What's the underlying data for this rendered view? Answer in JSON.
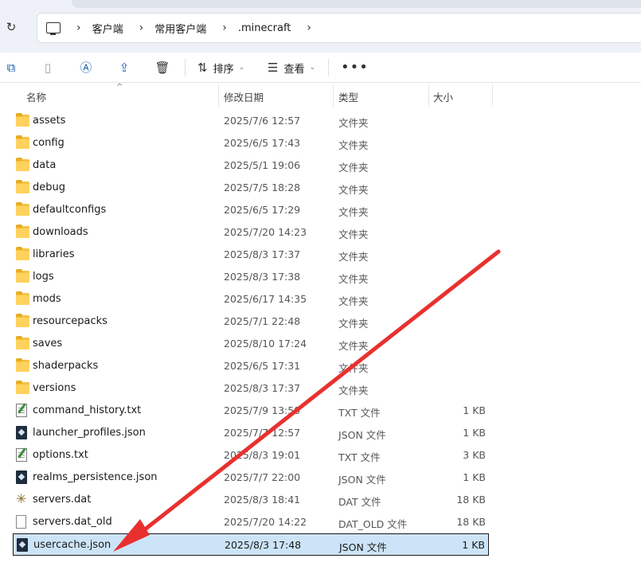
{
  "address": {
    "crumbs": [
      "客户端",
      "常用客户端",
      ".minecraft"
    ]
  },
  "toolbar": {
    "sort_label": "排序",
    "view_label": "查看"
  },
  "columns": {
    "name": "名称",
    "date": "修改日期",
    "type": "类型",
    "size": "大小"
  },
  "files": [
    {
      "icon": "folder-icon",
      "name": "assets",
      "date": "2025/7/6 12:57",
      "type": "文件夹",
      "size": ""
    },
    {
      "icon": "folder-icon",
      "name": "config",
      "date": "2025/6/5 17:43",
      "type": "文件夹",
      "size": ""
    },
    {
      "icon": "folder-icon",
      "name": "data",
      "date": "2025/5/1 19:06",
      "type": "文件夹",
      "size": ""
    },
    {
      "icon": "folder-icon",
      "name": "debug",
      "date": "2025/7/5 18:28",
      "type": "文件夹",
      "size": ""
    },
    {
      "icon": "folder-icon",
      "name": "defaultconfigs",
      "date": "2025/6/5 17:29",
      "type": "文件夹",
      "size": ""
    },
    {
      "icon": "folder-icon",
      "name": "downloads",
      "date": "2025/7/20 14:23",
      "type": "文件夹",
      "size": ""
    },
    {
      "icon": "folder-icon",
      "name": "libraries",
      "date": "2025/8/3 17:37",
      "type": "文件夹",
      "size": ""
    },
    {
      "icon": "folder-icon",
      "name": "logs",
      "date": "2025/8/3 17:38",
      "type": "文件夹",
      "size": ""
    },
    {
      "icon": "folder-icon",
      "name": "mods",
      "date": "2025/6/17 14:35",
      "type": "文件夹",
      "size": ""
    },
    {
      "icon": "folder-icon",
      "name": "resourcepacks",
      "date": "2025/7/1 22:48",
      "type": "文件夹",
      "size": ""
    },
    {
      "icon": "folder-icon",
      "name": "saves",
      "date": "2025/8/10 17:24",
      "type": "文件夹",
      "size": ""
    },
    {
      "icon": "folder-icon",
      "name": "shaderpacks",
      "date": "2025/6/5 17:31",
      "type": "文件夹",
      "size": ""
    },
    {
      "icon": "folder-icon",
      "name": "versions",
      "date": "2025/8/3 17:37",
      "type": "文件夹",
      "size": ""
    },
    {
      "icon": "text-file-icon",
      "name": "command_history.txt",
      "date": "2025/7/9 13:50",
      "type": "TXT 文件",
      "size": "1 KB"
    },
    {
      "icon": "json-file-icon",
      "name": "launcher_profiles.json",
      "date": "2025/7/7 12:57",
      "type": "JSON 文件",
      "size": "1 KB"
    },
    {
      "icon": "text-file-icon",
      "name": "options.txt",
      "date": "2025/8/3 19:01",
      "type": "TXT 文件",
      "size": "3 KB"
    },
    {
      "icon": "json-file-icon",
      "name": "realms_persistence.json",
      "date": "2025/7/7 22:00",
      "type": "JSON 文件",
      "size": "1 KB"
    },
    {
      "icon": "dat-file-icon",
      "name": "servers.dat",
      "date": "2025/8/3 18:41",
      "type": "DAT 文件",
      "size": "18 KB"
    },
    {
      "icon": "blank-file-icon",
      "name": "servers.dat_old",
      "date": "2025/7/20 14:22",
      "type": "DAT_OLD 文件",
      "size": "18 KB"
    },
    {
      "icon": "json-file-icon",
      "name": "usercache.json",
      "date": "2025/8/3 17:48",
      "type": "JSON 文件",
      "size": "1 KB",
      "selected": true
    }
  ],
  "annotation": {
    "arrow_color": "#e8312f"
  }
}
